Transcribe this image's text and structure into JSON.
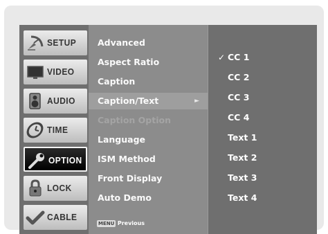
{
  "tabs": [
    {
      "label": "SETUP",
      "icon": "satellite-dish-icon",
      "active": false
    },
    {
      "label": "VIDEO",
      "icon": "monitor-icon",
      "active": false
    },
    {
      "label": "AUDIO",
      "icon": "speaker-icon",
      "active": false
    },
    {
      "label": "TIME",
      "icon": "clock-icon",
      "active": false
    },
    {
      "label": "OPTION",
      "icon": "wrench-icon",
      "active": true
    },
    {
      "label": "LOCK",
      "icon": "padlock-icon",
      "active": false
    },
    {
      "label": "CABLE",
      "icon": "cable-icon",
      "active": false
    }
  ],
  "submenu": {
    "items": [
      {
        "label": "Advanced"
      },
      {
        "label": "Aspect Ratio"
      },
      {
        "label": "Caption"
      },
      {
        "label": "Caption/Text",
        "selected": true,
        "has_submenu": true
      },
      {
        "label": "Caption Option",
        "disabled": true
      },
      {
        "label": "Language"
      },
      {
        "label": "ISM Method"
      },
      {
        "label": "Front Display"
      },
      {
        "label": "Auto Demo"
      }
    ],
    "arrow_glyph": "►",
    "footer": {
      "key": "MENU",
      "text": "Previous"
    }
  },
  "options": {
    "check_glyph": "✓",
    "items": [
      {
        "label": "CC 1",
        "checked": true
      },
      {
        "label": "CC 2"
      },
      {
        "label": "CC 3"
      },
      {
        "label": "CC 4"
      },
      {
        "label": "Text 1"
      },
      {
        "label": "Text 2"
      },
      {
        "label": "Text 3"
      },
      {
        "label": "Text 4"
      }
    ]
  },
  "colors": {
    "panel": "#6f6f6f",
    "submenu": "#8c8c8c",
    "highlight": "#9e9e9e",
    "active_tab": "#000000"
  }
}
